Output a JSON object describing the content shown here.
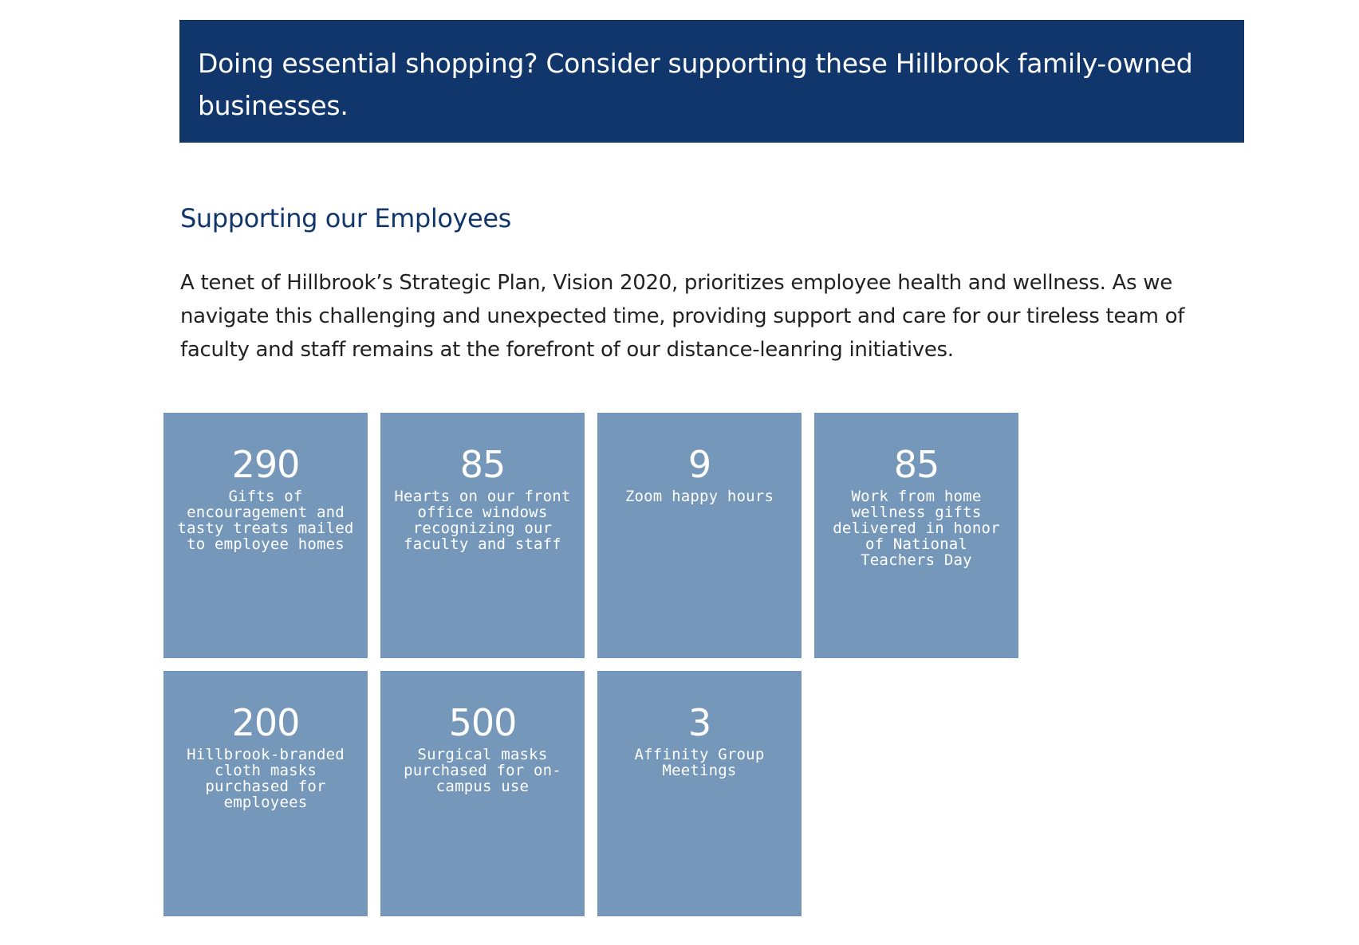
{
  "banner": {
    "text": "Doing essential shopping? Consider supporting these Hillbrook family-owned businesses."
  },
  "section": {
    "title": "Supporting our Employees",
    "intro": "A tenet of Hillbrook’s Strategic Plan, Vision 2020, prioritizes employee health and wellness. As we navigate this challenging and unexpected time, providing support and care for our tireless team of faculty and staff remains at the forefront of our distance-leanring initiatives."
  },
  "colors": {
    "banner_bg": "#10366b",
    "heading": "#10366b",
    "tile_bg": "#7597b9",
    "tile_text": "#ffffff"
  },
  "stats": [
    {
      "number": "290",
      "label": "Gifts of encouragement and tasty treats mailed to employee homes"
    },
    {
      "number": "85",
      "label": "Hearts on our front office windows recognizing our faculty and staff"
    },
    {
      "number": "9",
      "label": "Zoom happy hours"
    },
    {
      "number": "85",
      "label": "Work from home wellness gifts delivered in honor of National Teachers Day"
    },
    {
      "number": "200",
      "label": "Hillbrook-branded cloth masks purchased for employees"
    },
    {
      "number": "500",
      "label": "Surgical masks purchased for on-campus use"
    },
    {
      "number": "3",
      "label": "Affinity Group Meetings"
    }
  ]
}
